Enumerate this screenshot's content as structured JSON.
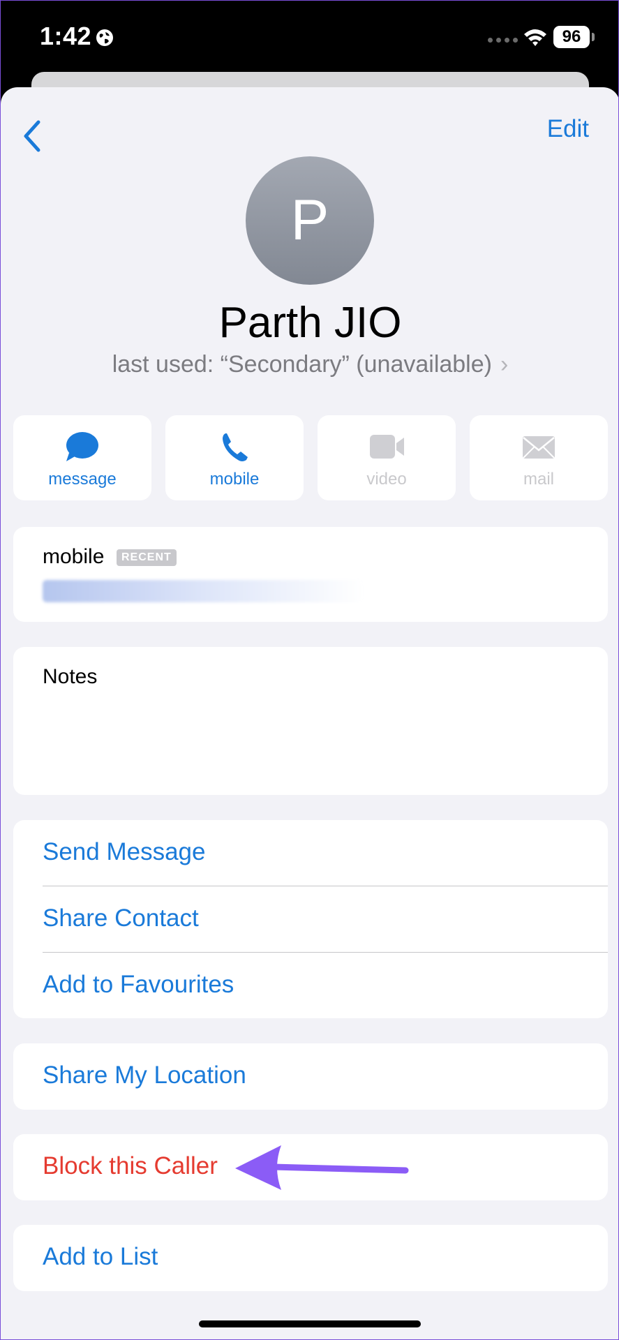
{
  "status_bar": {
    "time": "1:42",
    "battery": "96",
    "icons": [
      "globe-icon",
      "wifi-icon",
      "signal-dots",
      "battery-icon"
    ]
  },
  "nav": {
    "back_icon": "chevron-left-icon",
    "edit_label": "Edit"
  },
  "contact": {
    "initial": "P",
    "name": "Parth JIO",
    "last_used": "last used:  “Secondary” (unavailable)",
    "last_used_chevron": "›"
  },
  "actions": [
    {
      "label": "message",
      "icon": "message-bubble-icon",
      "enabled": true
    },
    {
      "label": "mobile",
      "icon": "phone-icon",
      "enabled": true
    },
    {
      "label": "video",
      "icon": "video-camera-icon",
      "enabled": false
    },
    {
      "label": "mail",
      "icon": "envelope-icon",
      "enabled": false
    }
  ],
  "phone": {
    "label": "mobile",
    "badge": "RECENT"
  },
  "notes": {
    "label": "Notes"
  },
  "menu_group_1": {
    "send_message": "Send Message",
    "share_contact": "Share Contact",
    "add_to_favourites": "Add to Favourites"
  },
  "menu_group_2": {
    "share_my_location": "Share My Location"
  },
  "menu_group_3": {
    "block_caller": "Block this Caller"
  },
  "menu_group_4": {
    "add_to_list": "Add to List"
  },
  "colors": {
    "accent": "#1a7ad9",
    "destructive": "#e53b30",
    "annotation_arrow": "#8b5cf6",
    "background": "#f2f2f7"
  }
}
